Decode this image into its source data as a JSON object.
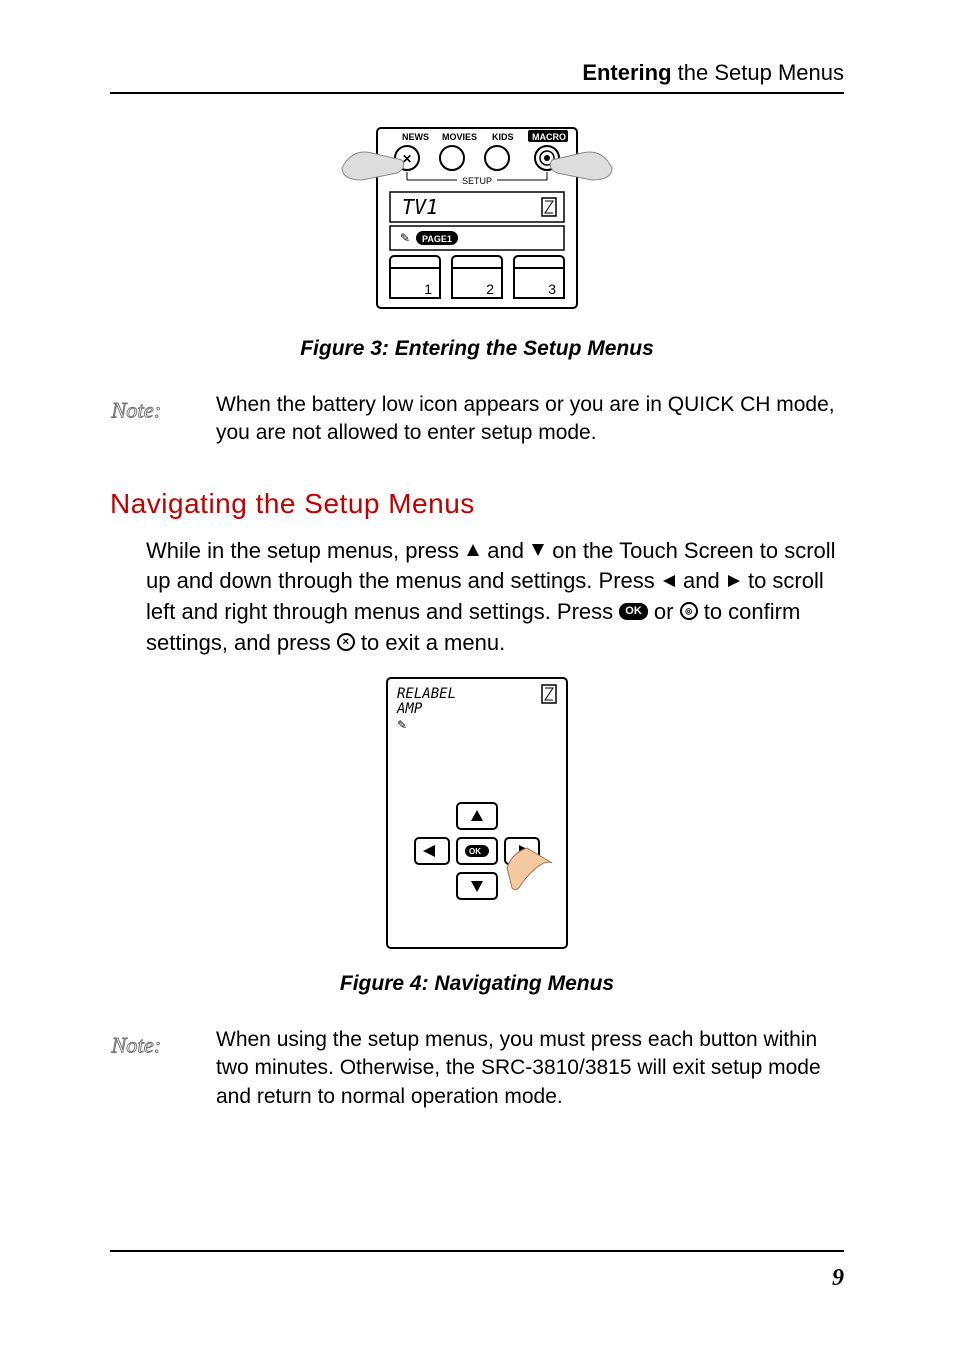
{
  "header": {
    "bold": "Entering",
    "rest": " the Setup Menus"
  },
  "figure3": {
    "caption": "Figure 3: Entering the Setup Menus",
    "labels": {
      "news": "NEWS",
      "movies": "MOVIES",
      "kids": "KIDS",
      "macro": "MACRO",
      "setup": "SETUP",
      "tv": "TV1",
      "page": "PAGE1",
      "k1": "1",
      "k2": "2",
      "k3": "3"
    }
  },
  "note1": "When the battery low icon appears or  you are in QUICK CH mode, you are not allowed to enter setup mode.",
  "section": {
    "title": "Navigating the Setup Menus"
  },
  "bodyPara": {
    "t1": "While in the setup menus, press ",
    "t2": " and ",
    "t3": " on the Touch Screen to scroll up and down through the menus and settings. Press ",
    "t4": " and ",
    "t5": " to scroll left and right through menus and settings. Press ",
    "t6": " or ",
    "t7": " to confirm settings, and press ",
    "t8": " to exit a menu."
  },
  "ok_label": "OK",
  "figure4": {
    "caption": "Figure 4: Navigating Menus",
    "labels": {
      "relabel": "RELABEL",
      "amp": "AMP",
      "ok": "OK"
    }
  },
  "note2": "When using the setup menus, you must press each button within two minutes. Otherwise, the SRC-3810/3815 will exit setup mode and return to normal operation mode.",
  "pageNumber": "9"
}
